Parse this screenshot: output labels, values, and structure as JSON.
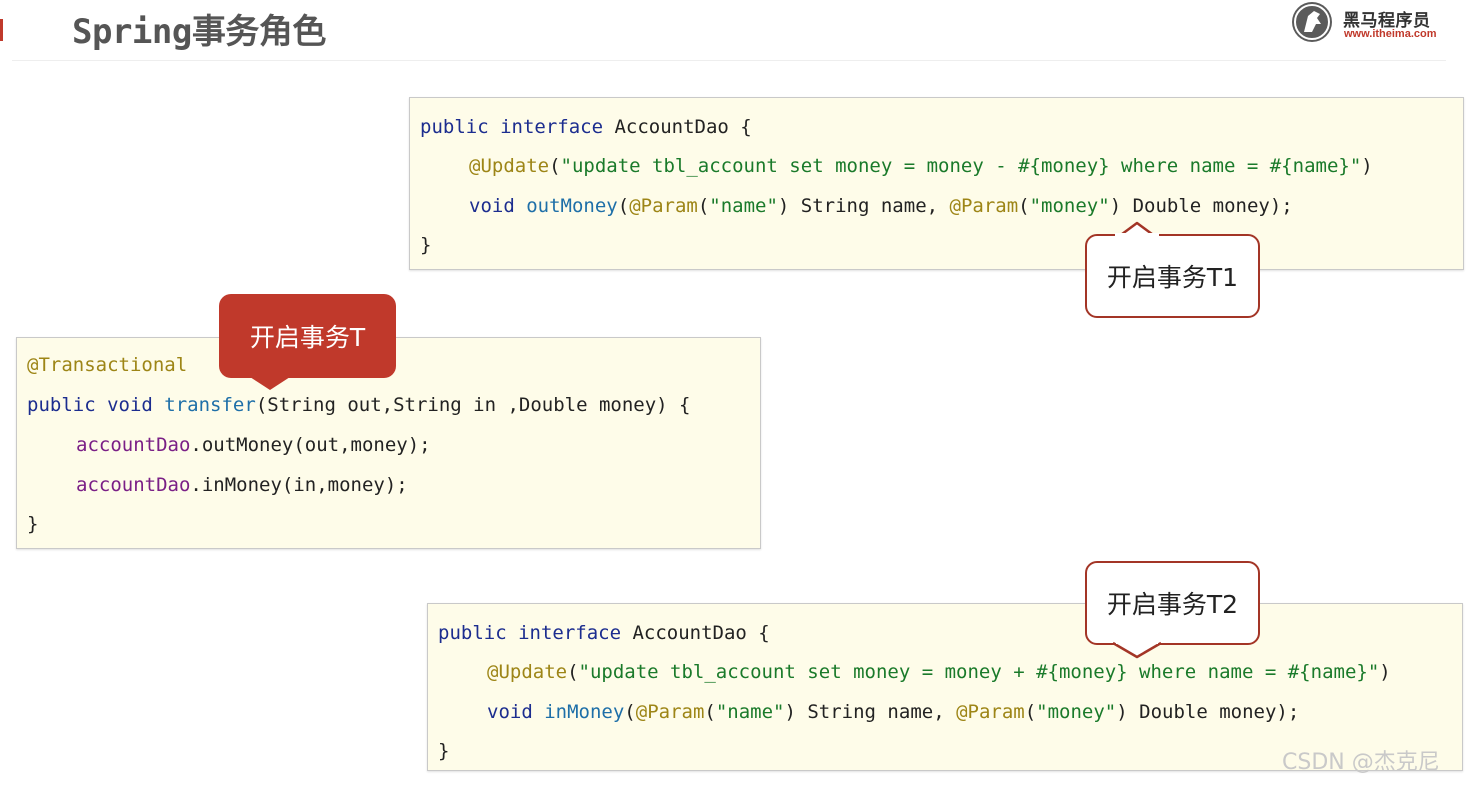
{
  "slide": {
    "title": "Spring事务角色"
  },
  "logo": {
    "icon": "horse-head-icon",
    "name": "黑马程序员",
    "url": "www.itheima.com",
    "accent_color": "#c0392b"
  },
  "code_top": {
    "line1": {
      "kw": "public interface",
      "rest": " AccountDao {"
    },
    "line2": {
      "ann": "@Update",
      "p1": "(",
      "str": "\"update tbl_account set money = money - #{money} where name = #{name}\"",
      "p2": ")"
    },
    "line3": {
      "kw": "void",
      "mth": "outMoney",
      "p1": "(",
      "ann1": "@Param",
      "p2": "(",
      "str1": "\"name\"",
      "p3": ") String name, ",
      "ann2": "@Param",
      "p4": "(",
      "str2": "\"money\"",
      "p5": ") Double money);"
    },
    "line4": "}"
  },
  "code_middle": {
    "line1": {
      "ann": "@Transactional"
    },
    "line2": {
      "kw": "public void",
      "mth": "transfer",
      "rest": "(String out,String in ,Double money) {"
    },
    "line3": {
      "fld": "accountDao",
      "rest": ".outMoney(out,money);"
    },
    "line4": {
      "fld": "accountDao",
      "rest": ".inMoney(in,money);"
    },
    "line5": "}"
  },
  "code_bottom": {
    "line1": {
      "kw": "public interface",
      "rest": " AccountDao {"
    },
    "line2": {
      "ann": "@Update",
      "p1": "(",
      "str": "\"update tbl_account set money = money + #{money} where name = #{name}\"",
      "p2": ")"
    },
    "line3": {
      "kw": "void",
      "mth": "inMoney",
      "p1": "(",
      "ann1": "@Param",
      "p2": "(",
      "str1": "\"name\"",
      "p3": ") String name, ",
      "ann2": "@Param",
      "p4": "(",
      "str2": "\"money\"",
      "p5": ") Double money);"
    },
    "line4": "}"
  },
  "callouts": {
    "t": "开启事务T",
    "t1": "开启事务T1",
    "t2": "开启事务T2"
  },
  "watermark": "CSDN @杰克尼"
}
